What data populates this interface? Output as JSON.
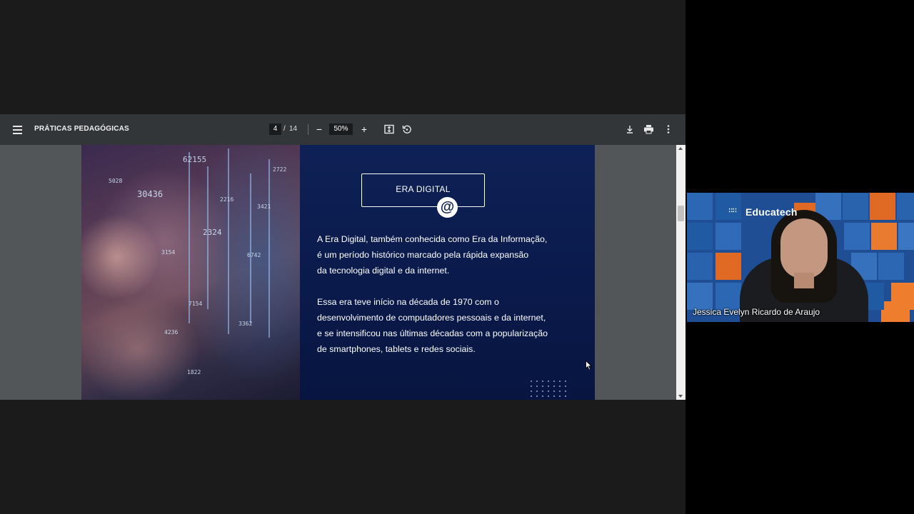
{
  "pdf_viewer": {
    "document_title": "PRÁTICAS PEDAGÓGICAS",
    "current_page": "4",
    "page_separator": "/",
    "total_pages": "14",
    "zoom": "50%",
    "icons": [
      "menu-icon",
      "zoom-out-icon",
      "zoom-in-icon",
      "fit-to-page-icon",
      "rotate-icon",
      "download-icon",
      "print-icon",
      "more-options-icon"
    ]
  },
  "slide": {
    "heading": "ERA DIGITAL",
    "heading_icon": "@",
    "paragraph1": [
      "A Era Digital, também conhecida como Era da Informação,",
      "é um período histórico marcado pela rápida expansão",
      "da tecnologia digital e da internet."
    ],
    "paragraph2": [
      "Essa era teve início na década de 1970 com o",
      "desenvolvimento de computadores pessoais e da internet,",
      "e se intensificou nas últimas décadas com a popularização",
      "de smartphones, tablets e redes sociais."
    ],
    "colors": {
      "panel": "#0e2156",
      "text": "#ffffff"
    }
  },
  "participant": {
    "logo": "Educatech",
    "name": "Jessica Evelyn Ricardo de Araujo"
  }
}
